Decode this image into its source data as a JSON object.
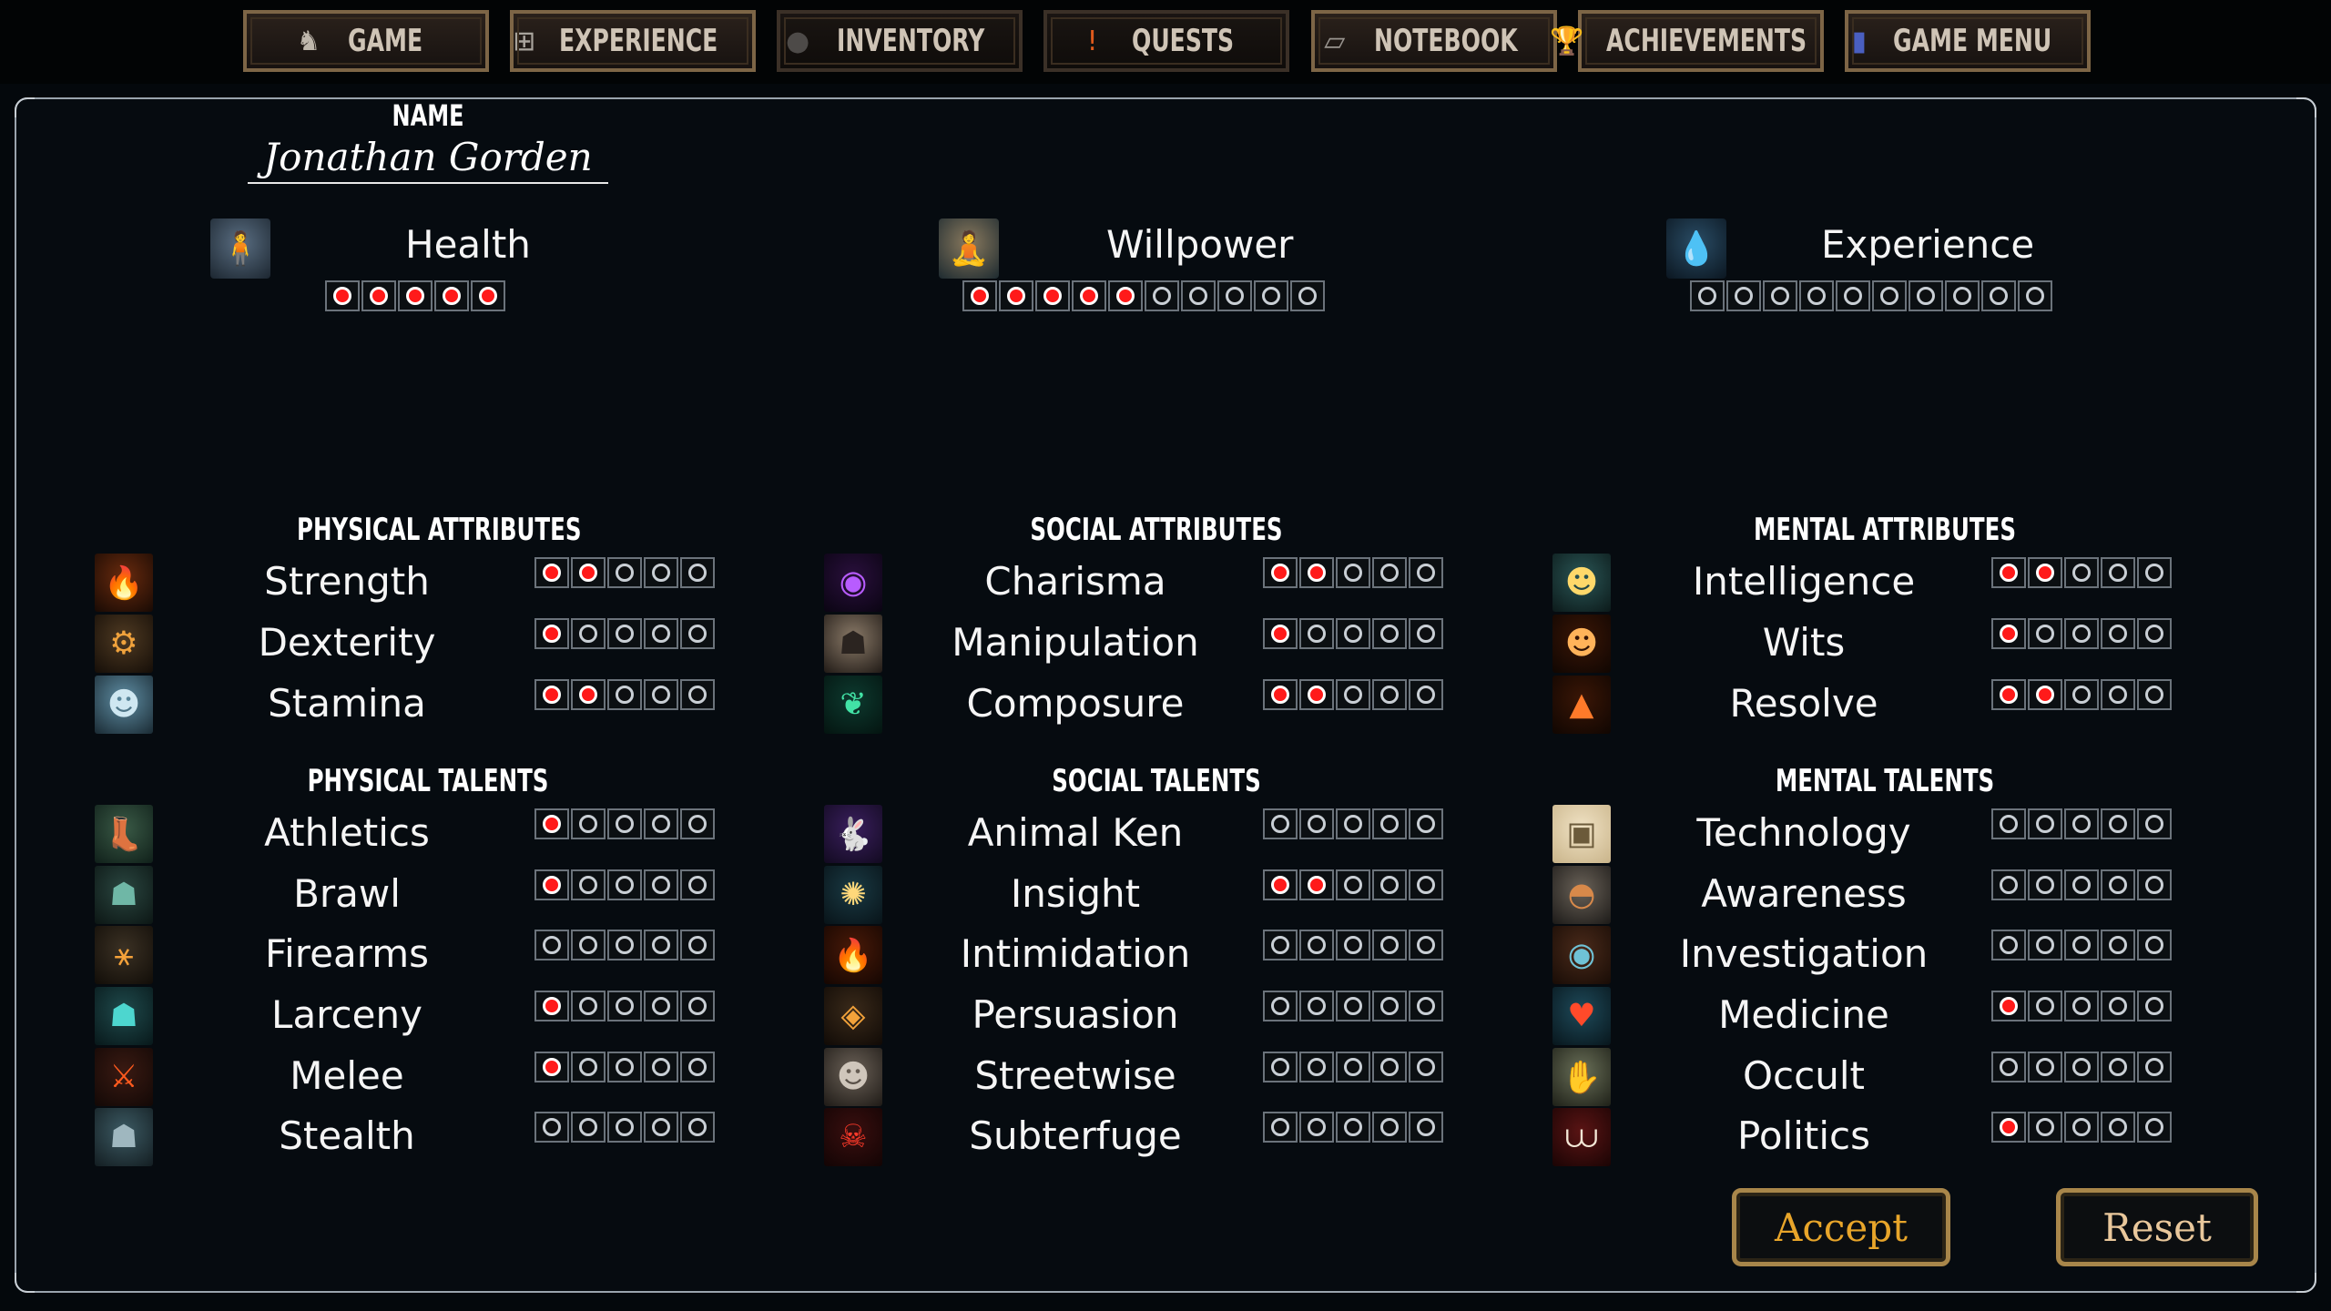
{
  "menu": [
    {
      "label": "GAME",
      "icon": "game-icon",
      "glyph": "♞",
      "color": "#bfb7ac"
    },
    {
      "label": "EXPERIENCE",
      "icon": "plus-icon",
      "glyph": "⊞",
      "color": "#a8a39c"
    },
    {
      "label": "INVENTORY",
      "icon": "bag-icon",
      "glyph": "●",
      "color": "#4d4a48"
    },
    {
      "label": "QUESTS",
      "icon": "exclamation-icon",
      "glyph": "!",
      "color": "#e05a1c"
    },
    {
      "label": "NOTEBOOK",
      "icon": "notebook-icon",
      "glyph": "▱",
      "color": "#9a9590"
    },
    {
      "label": "ACHIEVEMENTS",
      "icon": "trophy-icon",
      "glyph": "🏆",
      "color": "#aaa"
    },
    {
      "label": "GAME MENU",
      "icon": "book-icon",
      "glyph": "▮",
      "color": "#4a5fc0"
    }
  ],
  "character": {
    "name_caption": "NAME",
    "name": "Jonathan Gorden"
  },
  "meters": [
    {
      "label": "Health",
      "icon": "red-figure-icon",
      "value": 5,
      "max": 5
    },
    {
      "label": "Willpower",
      "icon": "meditating-figure-icon",
      "value": 5,
      "max": 10
    },
    {
      "label": "Experience",
      "icon": "droplet-icon",
      "value": 0,
      "max": 10
    }
  ],
  "columns": [
    {
      "attributes_title": "PHYSICAL ATTRIBUTES",
      "attributes": [
        {
          "label": "Strength",
          "icon": "flame-figure-icon",
          "value": 2
        },
        {
          "label": "Dexterity",
          "icon": "gear-icon",
          "value": 1
        },
        {
          "label": "Stamina",
          "icon": "stone-face-icon",
          "value": 2
        }
      ],
      "talents_title": "PHYSICAL TALENTS",
      "talents": [
        {
          "label": "Athletics",
          "icon": "boot-icon",
          "value": 1
        },
        {
          "label": "Brawl",
          "icon": "brute-icon",
          "value": 1
        },
        {
          "label": "Firearms",
          "icon": "gun-icon",
          "value": 0
        },
        {
          "label": "Larceny",
          "icon": "thief-icon",
          "value": 1
        },
        {
          "label": "Melee",
          "icon": "crossed-blades-icon",
          "value": 1
        },
        {
          "label": "Stealth",
          "icon": "cloaked-figure-icon",
          "value": 0
        }
      ]
    },
    {
      "attributes_title": "SOCIAL ATTRIBUTES",
      "attributes": [
        {
          "label": "Charisma",
          "icon": "purple-orb-icon",
          "value": 2
        },
        {
          "label": "Manipulation",
          "icon": "hooded-figure-icon",
          "value": 1
        },
        {
          "label": "Composure",
          "icon": "green-wings-icon",
          "value": 2
        }
      ],
      "talents_title": "SOCIAL TALENTS",
      "talents": [
        {
          "label": "Animal Ken",
          "icon": "purple-rabbit-icon",
          "value": 0
        },
        {
          "label": "Insight",
          "icon": "glowing-orb-icon",
          "value": 2
        },
        {
          "label": "Intimidation",
          "icon": "fire-figure-icon",
          "value": 0
        },
        {
          "label": "Persuasion",
          "icon": "eye-diamond-icon",
          "value": 0
        },
        {
          "label": "Streetwise",
          "icon": "stone-head-icon",
          "value": 0
        },
        {
          "label": "Subterfuge",
          "icon": "demon-mask-icon",
          "value": 0
        }
      ]
    },
    {
      "attributes_title": "MENTAL ATTRIBUTES",
      "attributes": [
        {
          "label": "Intelligence",
          "icon": "glowing-head-icon",
          "value": 2
        },
        {
          "label": "Wits",
          "icon": "flame-head-icon",
          "value": 1
        },
        {
          "label": "Resolve",
          "icon": "hooded-flame-icon",
          "value": 2
        }
      ],
      "talents_title": "MENTAL TALENTS",
      "talents": [
        {
          "label": "Technology",
          "icon": "computer-icon",
          "value": 0
        },
        {
          "label": "Awareness",
          "icon": "turtle-icon",
          "value": 0
        },
        {
          "label": "Investigation",
          "icon": "eye-icon",
          "value": 0
        },
        {
          "label": "Medicine",
          "icon": "heart-icon",
          "value": 1
        },
        {
          "label": "Occult",
          "icon": "hand-icon",
          "value": 0
        },
        {
          "label": "Politics",
          "icon": "teeth-icon",
          "value": 1
        }
      ]
    }
  ],
  "talent_max": 5,
  "actions": {
    "accept": "Accept",
    "reset": "Reset"
  },
  "colors": {
    "dot_filled": "#ff1a1a",
    "accept_text": "#e8a52a",
    "reset_text": "#e9c79b",
    "button_border": "#a8864a"
  }
}
